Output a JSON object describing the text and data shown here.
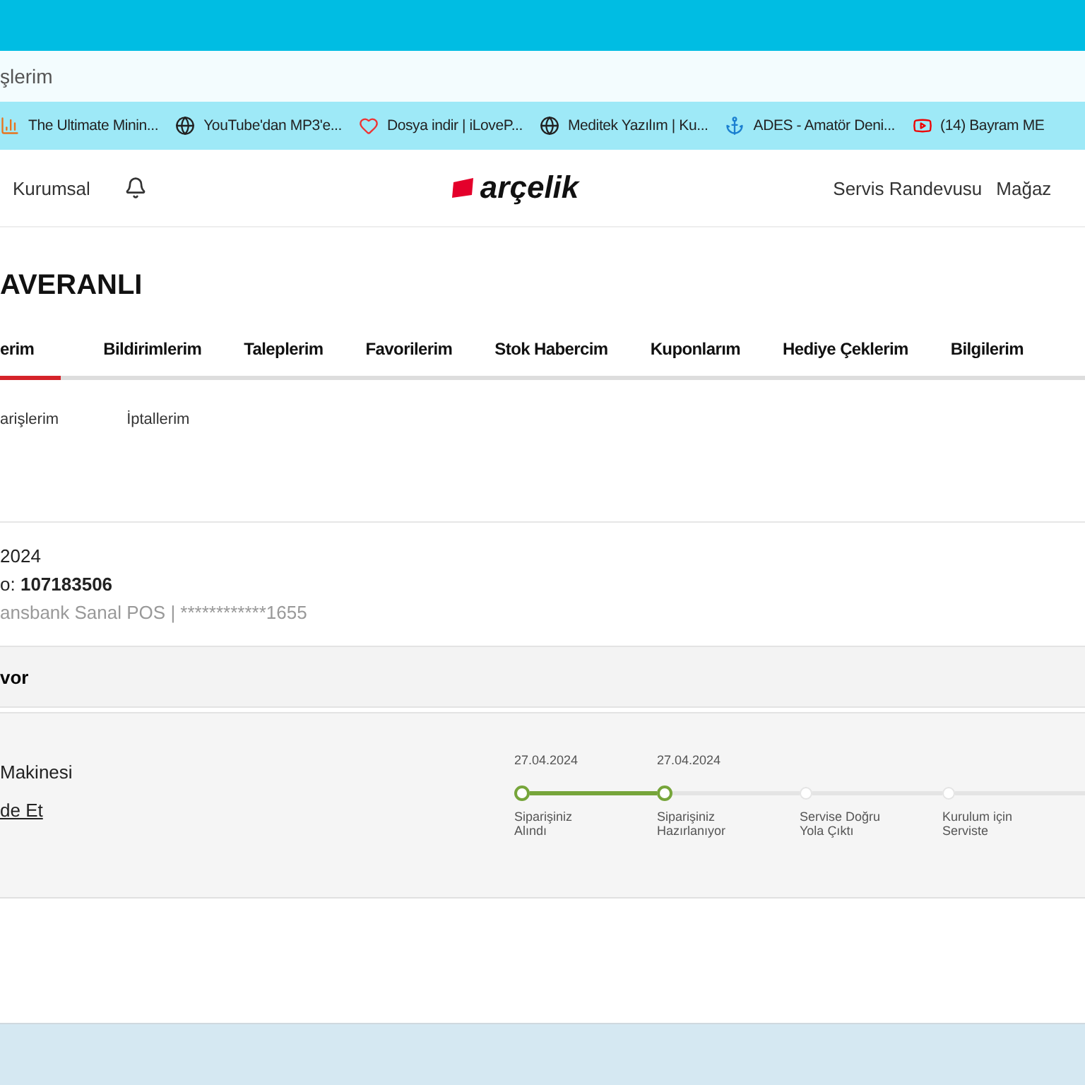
{
  "address_bar": {
    "value": "şlerim"
  },
  "bookmarks": [
    {
      "kind": "bars",
      "label": "The Ultimate Minin..."
    },
    {
      "kind": "globe",
      "label": "YouTube'dan MP3'e..."
    },
    {
      "kind": "heart",
      "label": "Dosya indir | iLoveP..."
    },
    {
      "kind": "globe",
      "label": "Meditek Yazılım | Ku..."
    },
    {
      "kind": "anchor",
      "label": "ADES - Amatör Deni..."
    },
    {
      "kind": "video",
      "label": "(14) Bayram ME"
    }
  ],
  "header": {
    "left_link": "Kurumsal",
    "logo": "arçelik",
    "right_links": [
      "Servis Randevusu",
      "Mağaz"
    ]
  },
  "user_name": "AVERANLI",
  "tabs": [
    {
      "label": "erim",
      "selected": true
    },
    {
      "label": "Bildirimlerim",
      "selected": false
    },
    {
      "label": "Taleplerim",
      "selected": false
    },
    {
      "label": "Favorilerim",
      "selected": false
    },
    {
      "label": "Stok Habercim",
      "selected": false
    },
    {
      "label": "Kuponlarım",
      "selected": false
    },
    {
      "label": "Hediye Çeklerim",
      "selected": false
    },
    {
      "label": "Bilgilerim",
      "selected": false
    }
  ],
  "subtabs": [
    "arişlerim",
    "İptallerim"
  ],
  "order": {
    "date": "2024",
    "number_label": "o:",
    "number": "107183506",
    "payment": "ansbank Sanal POS | ************1655",
    "status": "vor"
  },
  "product": {
    "name": "Makinesi",
    "link": "de Et"
  },
  "steps": [
    {
      "date": "27.04.2024",
      "label": "Siparişiniz Alındı",
      "done": true
    },
    {
      "date": "27.04.2024",
      "label": "Siparişiniz Hazırlanıyor",
      "done": true
    },
    {
      "label": "Servise Doğru Yola Çıktı",
      "done": false
    },
    {
      "label": "Kurulum için Serviste",
      "done": false
    }
  ]
}
